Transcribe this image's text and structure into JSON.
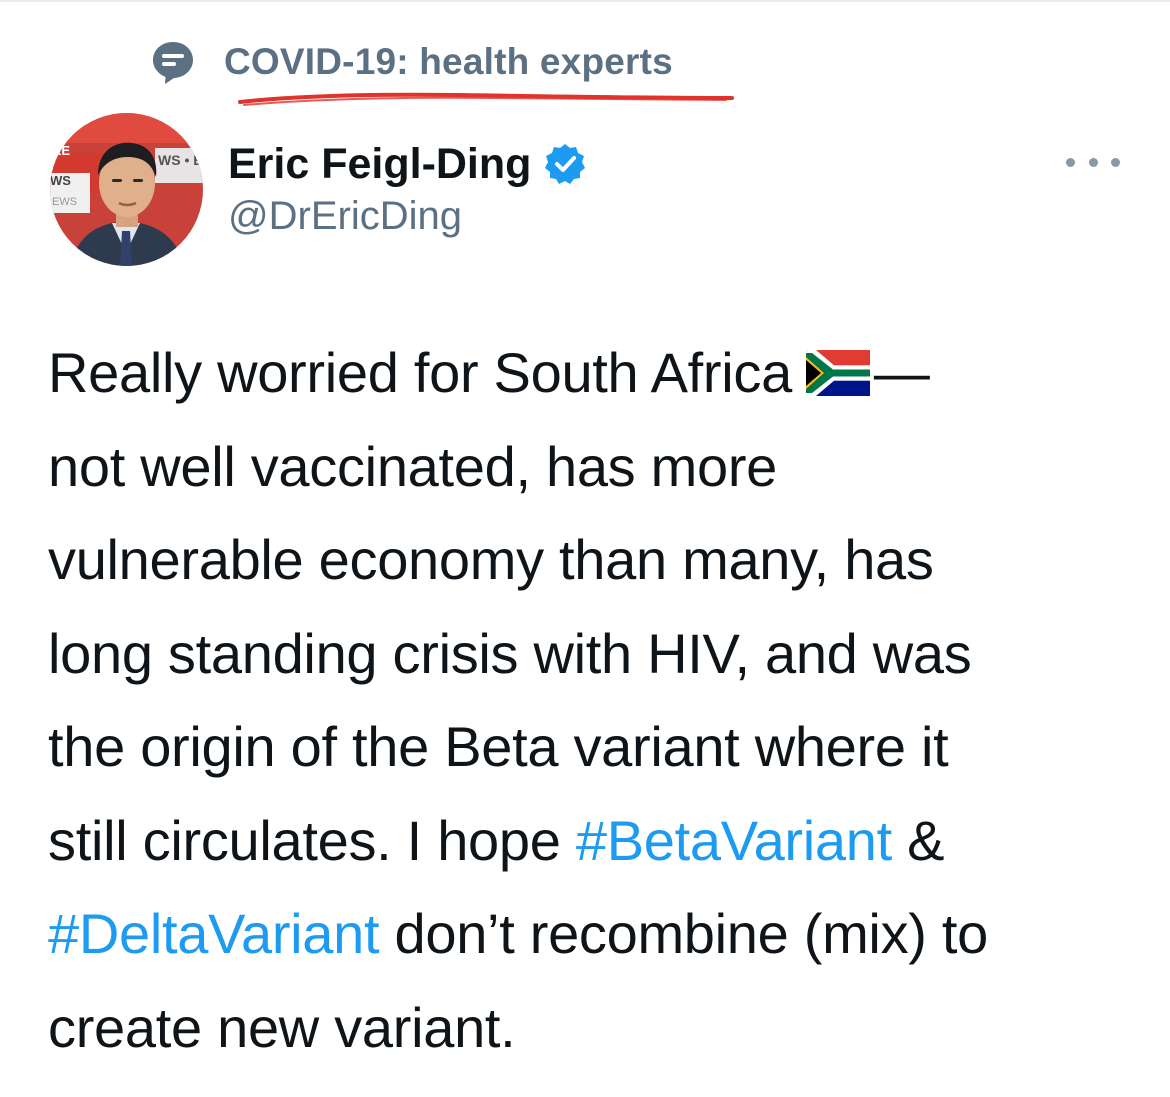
{
  "topic": {
    "icon": "topic-speech-bubble-icon",
    "label": "COVID-19: health experts",
    "underline_color": "#e0332b"
  },
  "author": {
    "name": "Eric Feigl-Ding",
    "handle": "@DrEricDing",
    "verified": true,
    "avatar_backdrop_text": [
      "RE",
      "WS",
      "EWS",
      "WS • E"
    ]
  },
  "more_menu": {
    "icon": "more-horizontal-icon"
  },
  "tweet": {
    "flag_icon": "south-africa-flag-icon",
    "line1": {
      "text": "Really worried for South Africa",
      "after_flag": "—"
    },
    "line2": "not well vaccinated, has more",
    "line3": "vulnerable economy than many, has",
    "line4": "long standing crisis with HIV, and was",
    "line5": "the origin of the Beta variant where it",
    "line6": {
      "pre": "still circulates. I hope ",
      "hashtag": "#BetaVariant",
      "post": " &"
    },
    "line7": {
      "hashtag": "#DeltaVariant",
      "post": " don’t recombine (mix) to"
    },
    "line8": "create new variant."
  },
  "colors": {
    "text_primary": "#0f1419",
    "text_secondary": "#5b7083",
    "link": "#1d9bf0",
    "verified_badge": "#1d9bf0"
  }
}
